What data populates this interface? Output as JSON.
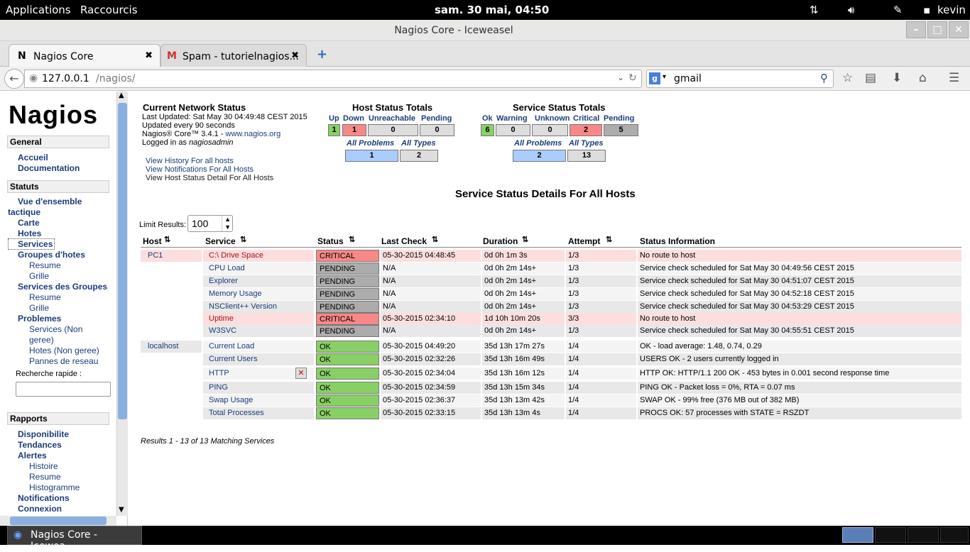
{
  "topbar": {
    "applications": "Applications",
    "raccourcis": "Raccourcis",
    "clock": "sam. 30 mai, 04:50",
    "user": "kevin"
  },
  "window": {
    "title": "Nagios Core - Iceweasel"
  },
  "tabs": [
    {
      "icon": "N",
      "label": "Nagios Core"
    },
    {
      "icon": "M",
      "label": "Spam - tutorielnagios..."
    }
  ],
  "nav": {
    "url_host": "127.0.0.1",
    "url_path": "/nagios/",
    "search_value": "gmail"
  },
  "sidebar": {
    "logo": "Nagios",
    "general": "General",
    "accueil": "Accueil",
    "documentation": "Documentation",
    "statuts": "Statuts",
    "vue1": "Vue d'ensemble",
    "vue2": "tactique",
    "carte": "Carte",
    "hotes": "Hotes",
    "services": "Services",
    "groupes_hotes": "Groupes d'hotes",
    "resume1": "Resume",
    "grille1": "Grille",
    "services_groupes": "Services des Groupes",
    "resume2": "Resume",
    "grille2": "Grille",
    "problemes": "Problemes",
    "prob_services": "Services",
    "non_geree1a": "Non",
    "non_geree1b": "geree",
    "prob_hotes": "Hotes",
    "non_geree2": "Non geree",
    "pannes": "Pannes de reseau",
    "recherche": "Recherche rapide :",
    "rapports": "Rapports",
    "disponibilite": "Disponibilite",
    "tendances": "Tendances",
    "alertes": "Alertes",
    "histoire": "Histoire",
    "resume3": "Resume",
    "histogramme": "Histogramme",
    "notifications": "Notifications",
    "connexion": "Connexion"
  },
  "network": {
    "title": "Current Network Status",
    "updated": "Last Updated: Sat May 30 04:49:48 CEST 2015",
    "every": "Updated every 90 seconds",
    "core": "Nagios® Core™ 3.4.1 - ",
    "site": "www.nagios.org",
    "logged": "Logged in as ",
    "user": "nagiosadmin",
    "link1": "View History For all hosts",
    "link2": "View Notifications For All Hosts",
    "link3": "View Host Status Detail For All Hosts"
  },
  "host_totals": {
    "title": "Host Status Totals",
    "labels": [
      "Up",
      "Down",
      "Unreachable",
      "Pending"
    ],
    "values": [
      "1",
      "1",
      "0",
      "0"
    ],
    "all_problems": "All Problems",
    "all_types": "All Types",
    "ap": "1",
    "at": "2"
  },
  "service_totals": {
    "title": "Service Status Totals",
    "labels": [
      "Ok",
      "Warning",
      "Unknown",
      "Critical",
      "Pending"
    ],
    "values": [
      "6",
      "0",
      "0",
      "2",
      "5"
    ],
    "all_problems": "All Problems",
    "all_types": "All Types",
    "ap": "2",
    "at": "13"
  },
  "details": {
    "title": "Service Status Details For All Hosts",
    "limit_label": "Limit Results:",
    "limit_value": "100",
    "columns": [
      "Host",
      "Service",
      "Status",
      "Last Check",
      "Duration",
      "Attempt",
      "Status Information"
    ],
    "results": "Results 1 - 13 of 13 Matching Services"
  },
  "rows": [
    {
      "host": "PC1",
      "service": "C:\\ Drive Space",
      "status": "CRITICAL",
      "last": "05-30-2015 04:48:45",
      "dur": "0d 0h 1m 3s",
      "att": "1/3",
      "info": "No route to host"
    },
    {
      "host": "",
      "service": "CPU Load",
      "status": "PENDING",
      "last": "N/A",
      "dur": "0d 0h 2m 14s+",
      "att": "1/3",
      "info": "Service check scheduled for Sat May 30 04:49:56 CEST 2015"
    },
    {
      "host": "",
      "service": "Explorer",
      "status": "PENDING",
      "last": "N/A",
      "dur": "0d 0h 2m 14s+",
      "att": "1/3",
      "info": "Service check scheduled for Sat May 30 04:51:07 CEST 2015"
    },
    {
      "host": "",
      "service": "Memory Usage",
      "status": "PENDING",
      "last": "N/A",
      "dur": "0d 0h 2m 14s+",
      "att": "1/3",
      "info": "Service check scheduled for Sat May 30 04:52:18 CEST 2015"
    },
    {
      "host": "",
      "service": "NSClient++ Version",
      "status": "PENDING",
      "last": "N/A",
      "dur": "0d 0h 2m 14s+",
      "att": "1/3",
      "info": "Service check scheduled for Sat May 30 04:53:29 CEST 2015"
    },
    {
      "host": "",
      "service": "Uptime",
      "status": "CRITICAL",
      "last": "05-30-2015 02:34:10",
      "dur": "1d 10h 10m 20s",
      "att": "3/3",
      "info": "No route to host"
    },
    {
      "host": "",
      "service": "W3SVC",
      "status": "PENDING",
      "last": "N/A",
      "dur": "0d 0h 2m 14s+",
      "att": "1/3",
      "info": "Service check scheduled for Sat May 30 04:55:51 CEST 2015"
    },
    {
      "host": "localhost",
      "service": "Current Load",
      "status": "OK",
      "last": "05-30-2015 04:49:20",
      "dur": "35d 13h 17m 27s",
      "att": "1/4",
      "info": "OK - load average: 1.48, 0.74, 0.29"
    },
    {
      "host": "",
      "service": "Current Users",
      "status": "OK",
      "last": "05-30-2015 02:32:26",
      "dur": "35d 13h 16m 49s",
      "att": "1/4",
      "info": "USERS OK - 2 users currently logged in"
    },
    {
      "host": "",
      "service": "HTTP",
      "status": "OK",
      "last": "05-30-2015 02:34:04",
      "dur": "35d 13h 16m 12s",
      "att": "1/4",
      "info": "HTTP OK: HTTP/1.1 200 OK - 453 bytes in 0.001 second response time"
    },
    {
      "host": "",
      "service": "PING",
      "status": "OK",
      "last": "05-30-2015 02:34:59",
      "dur": "35d 13h 15m 34s",
      "att": "1/4",
      "info": "PING OK - Packet loss = 0%, RTA = 0.07 ms"
    },
    {
      "host": "",
      "service": "Swap Usage",
      "status": "OK",
      "last": "05-30-2015 02:36:37",
      "dur": "35d 13h 13m 42s",
      "att": "1/4",
      "info": "SWAP OK - 99% free (376 MB out of 382 MB)"
    },
    {
      "host": "",
      "service": "Total Processes",
      "status": "OK",
      "last": "05-30-2015 02:33:15",
      "dur": "35d 13h 13m 4s",
      "att": "1/4",
      "info": "PROCS OK: 57 processes with STATE = RSZDT"
    }
  ],
  "taskbar": {
    "item": "Nagios Core - Icewea..."
  },
  "colors": {
    "critical": "#f88888",
    "pending": "#acacac",
    "ok": "#88d066",
    "critical_row": "#fddede",
    "even_row": "#e8e8e8",
    "odd_row": "#f4f4f4",
    "link": "#1a3d7a"
  }
}
